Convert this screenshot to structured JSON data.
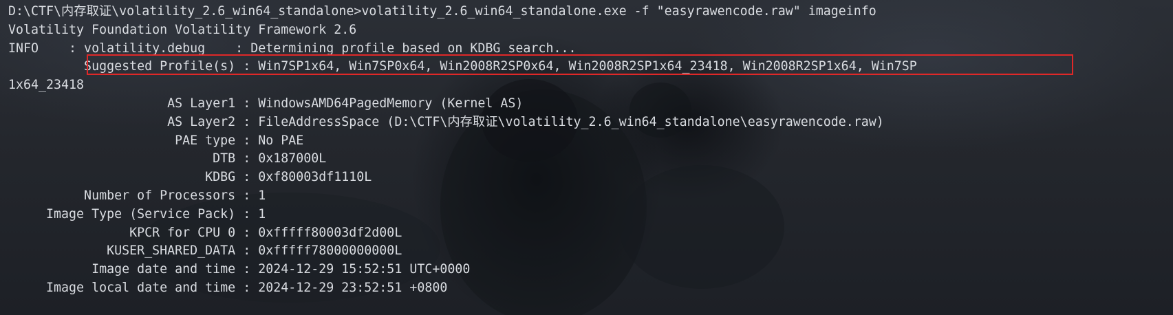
{
  "terminal": {
    "lines": [
      "D:\\CTF\\内存取证\\volatility_2.6_win64_standalone>volatility_2.6_win64_standalone.exe -f \"easyrawencode.raw\" imageinfo",
      "Volatility Foundation Volatility Framework 2.6",
      "INFO    : volatility.debug    : Determining profile based on KDBG search...",
      "          Suggested Profile(s) : Win7SP1x64, Win7SP0x64, Win2008R2SP0x64, Win2008R2SP1x64_23418, Win2008R2SP1x64, Win7SP",
      "1x64_23418",
      "                     AS Layer1 : WindowsAMD64PagedMemory (Kernel AS)",
      "                     AS Layer2 : FileAddressSpace (D:\\CTF\\内存取证\\volatility_2.6_win64_standalone\\easyrawencode.raw)",
      "                      PAE type : No PAE",
      "                           DTB : 0x187000L",
      "                          KDBG : 0xf80003df1110L",
      "          Number of Processors : 1",
      "     Image Type (Service Pack) : 1",
      "                KPCR for CPU 0 : 0xfffff80003df2d00L",
      "             KUSER_SHARED_DATA : 0xfffff78000000000L",
      "           Image date and time : 2024-12-29 15:52:51 UTC+0000",
      "     Image local date and time : 2024-12-29 23:52:51 +0800"
    ]
  },
  "colors": {
    "text": "#d9dce1",
    "highlight_border": "#e02828",
    "background": "#24272d"
  }
}
